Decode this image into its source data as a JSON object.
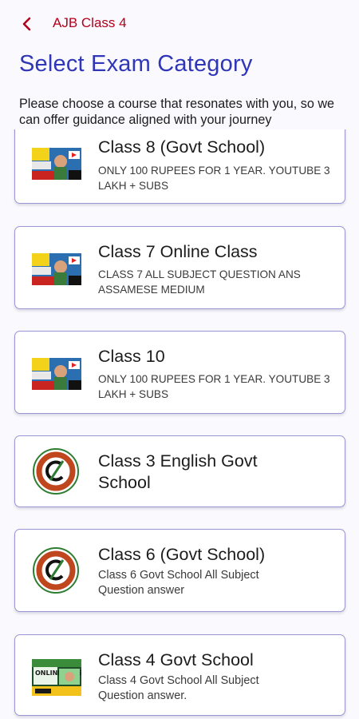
{
  "header": {
    "back_icon": "chevron-left-icon",
    "app_title": "AJB Class 4"
  },
  "page": {
    "title": "Select Exam Category",
    "intro": "Please choose a course that resonates with you, so we can offer guidance aligned with your journey"
  },
  "categories": [
    {
      "title": "Class 8 (Govt School)",
      "subtitle": "ONLY 100 RUPEES FOR 1 YEAR. YOUTUBE 3 LAKH + SUBS",
      "image": "youtube-thumbnail"
    },
    {
      "title": "Class 7 Online Class",
      "subtitle": "CLASS 7 ALL SUBJECT QUESTION ANS ASSAMESE MEDIUM",
      "image": "youtube-thumbnail"
    },
    {
      "title": "Class 10",
      "subtitle": "ONLY 100 RUPEES FOR 1 YEAR. YOUTUBE 3 LAKH + SUBS",
      "image": "youtube-thumbnail"
    },
    {
      "title": "Class 3 English Govt School",
      "subtitle": "",
      "image": "circular-logo"
    },
    {
      "title": "Class 6 (Govt School)",
      "subtitle": "Class 6 Govt School All Subject Question answer",
      "image": "circular-logo"
    },
    {
      "title": "Class 4 Govt School",
      "subtitle": "Class 4 Govt School All Subject Question answer.",
      "image": "online-class-banner",
      "banner_text": "ONLINE CLASS"
    }
  ],
  "colors": {
    "accent": "#2f36b8",
    "header_red": "#b3001b",
    "card_border": "#9a96d4",
    "background": "#faf9fd"
  }
}
